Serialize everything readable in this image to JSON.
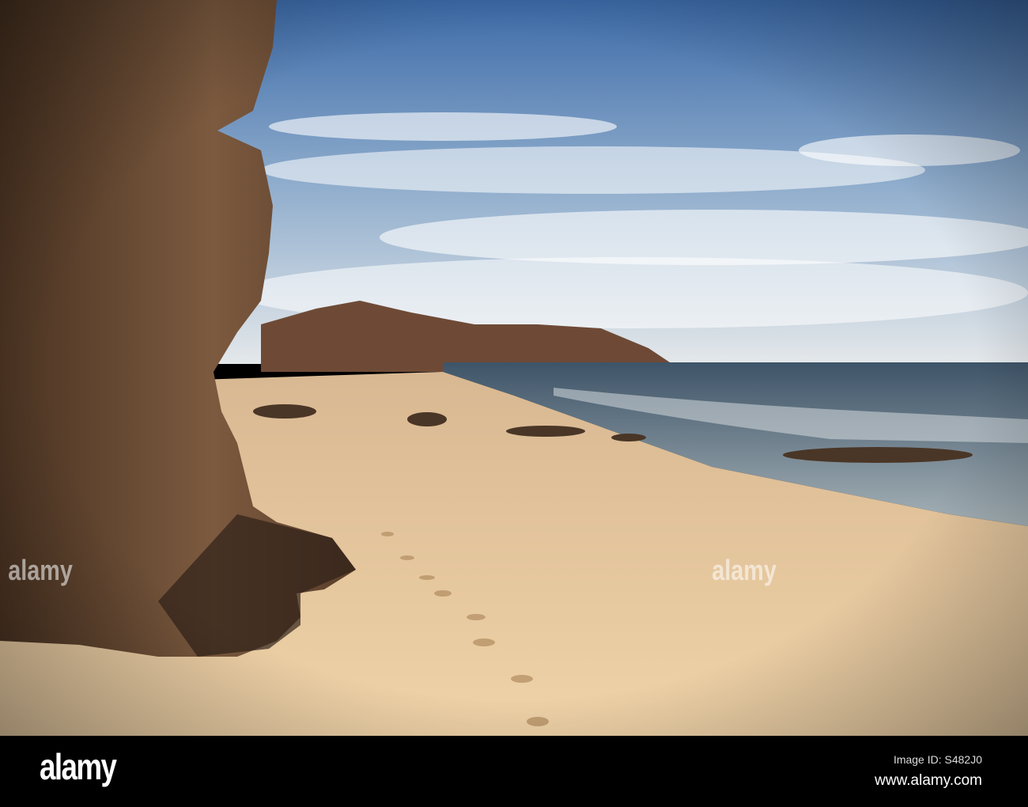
{
  "photo": {
    "subject": "beach"
  },
  "watermark": {
    "text": "alamy"
  },
  "footer": {
    "logo": "alamy",
    "image_id": "Image ID: S482J0",
    "website": "www.alamy.com"
  },
  "colors": {
    "sky_top": "#3f6fae",
    "sky_bottom": "#dfe6ec",
    "sand": "#e9caa0",
    "rock": "#6e4c33",
    "sea": "#4f6474"
  }
}
